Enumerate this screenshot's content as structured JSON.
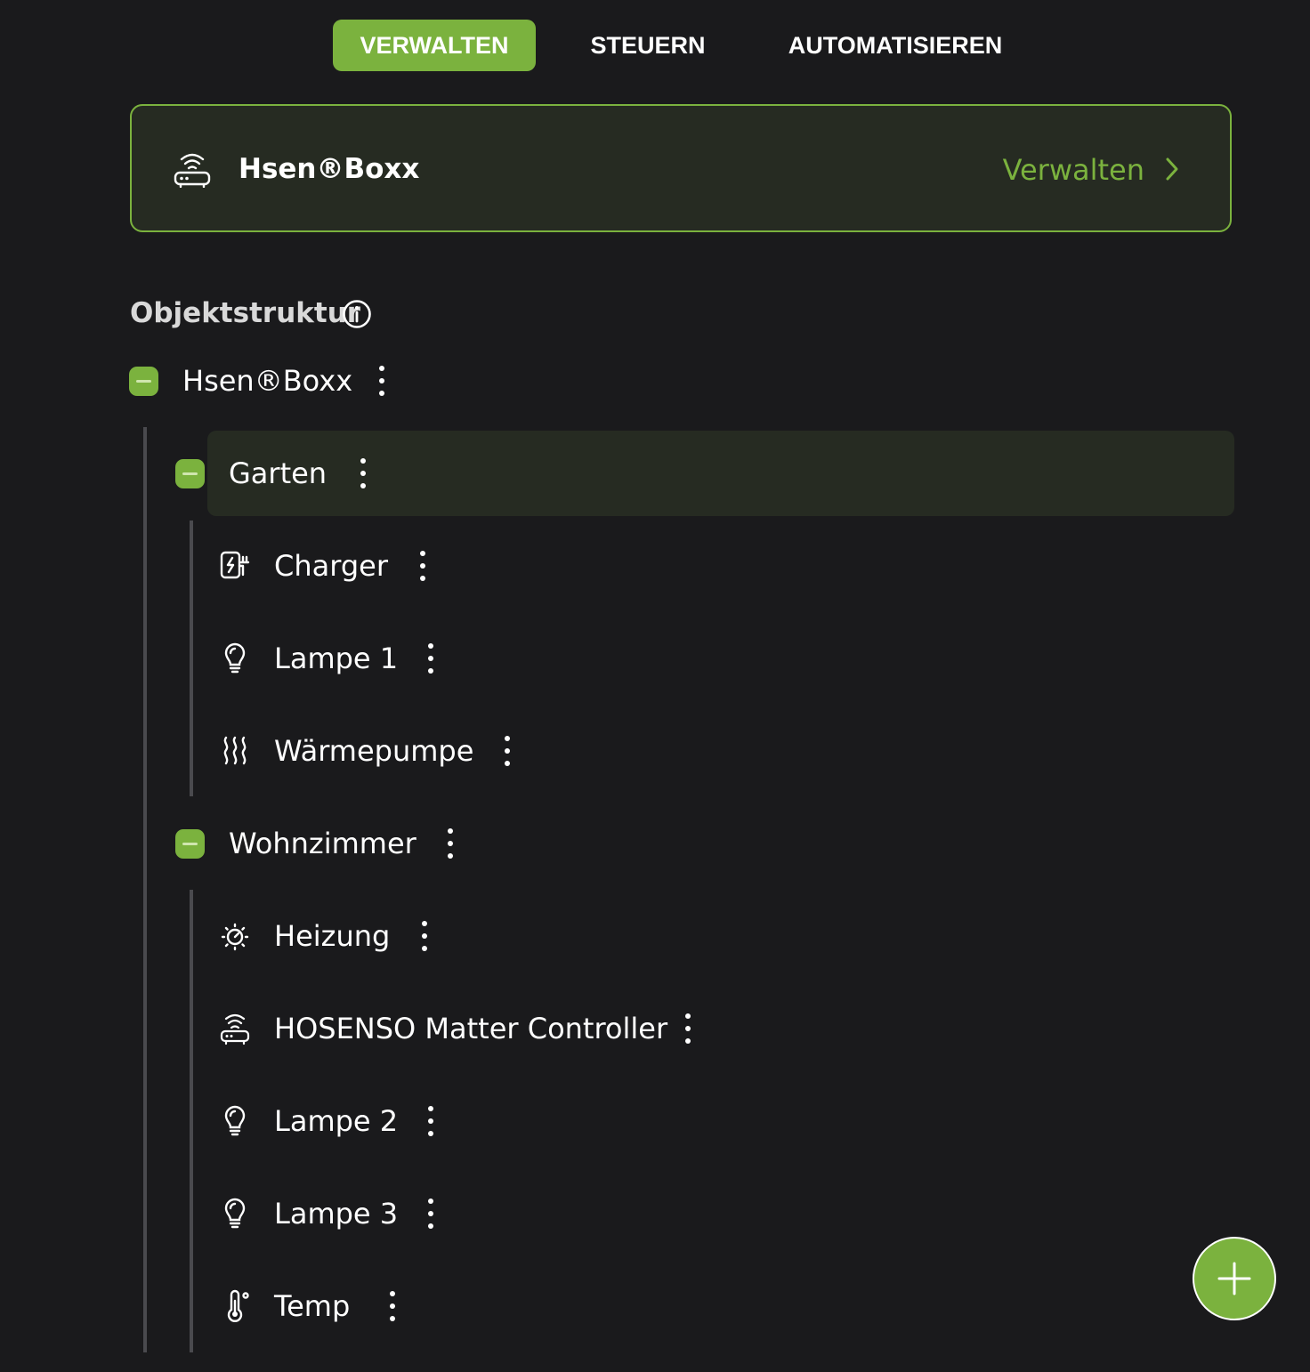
{
  "tabs": [
    {
      "label": "VERWALTEN",
      "active": true
    },
    {
      "label": "STEUERN",
      "active": false
    },
    {
      "label": "AUTOMATISIEREN",
      "active": false
    }
  ],
  "hub": {
    "icon": "router-icon",
    "name": "Hsen®Boxx",
    "manage_label": "Verwalten"
  },
  "structure": {
    "title": "Objektstruktur",
    "root": {
      "name": "Hsen®Boxx",
      "rooms": [
        {
          "name": "Garten",
          "selected": true,
          "devices": [
            {
              "name": "Charger",
              "icon": "ev-charger-icon"
            },
            {
              "name": "Lampe 1",
              "icon": "bulb-icon"
            },
            {
              "name": "Wärmepumpe",
              "icon": "heat-waves-icon"
            }
          ]
        },
        {
          "name": "Wohnzimmer",
          "selected": false,
          "devices": [
            {
              "name": "Heizung",
              "icon": "thermostat-dial-icon"
            },
            {
              "name": "HOSENSO Matter Controller",
              "icon": "router-icon"
            },
            {
              "name": "Lampe 2",
              "icon": "bulb-icon"
            },
            {
              "name": "Lampe 3",
              "icon": "bulb-icon"
            },
            {
              "name": "Temp",
              "icon": "thermometer-icon"
            }
          ]
        }
      ]
    }
  },
  "colors": {
    "accent": "#7bb23e",
    "background": "#1a1a1c",
    "card": "#262b22"
  }
}
